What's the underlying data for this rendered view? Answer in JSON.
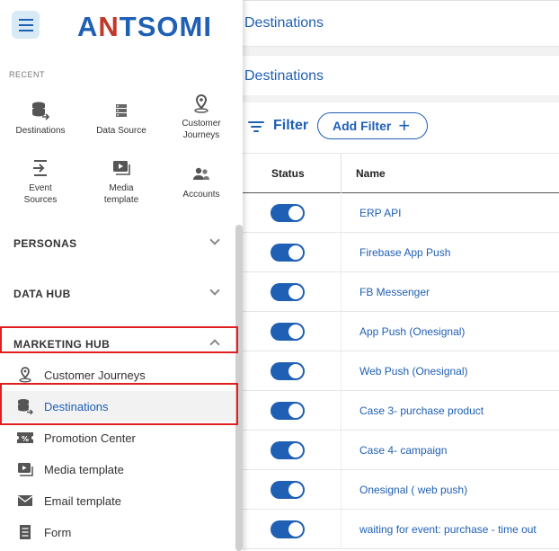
{
  "page": {
    "title": "Destinations",
    "subtitle": "Destinations"
  },
  "filter": {
    "label": "Filter",
    "add_label": "Add Filter",
    "add_icon": "plus-icon"
  },
  "table": {
    "columns": [
      "Status",
      "Name"
    ],
    "rows": [
      {
        "status": "on",
        "name": "ERP API"
      },
      {
        "status": "on",
        "name": "Firebase App Push"
      },
      {
        "status": "on",
        "name": "FB Messenger"
      },
      {
        "status": "on",
        "name": "App Push (Onesignal)"
      },
      {
        "status": "on",
        "name": "Web Push (Onesignal)"
      },
      {
        "status": "on",
        "name": "Case 3- purchase product"
      },
      {
        "status": "on",
        "name": "Case 4- campaign"
      },
      {
        "status": "on",
        "name": "Onesignal ( web push)"
      },
      {
        "status": "on",
        "name": "waiting for event: purchase - time out"
      }
    ]
  },
  "drawer": {
    "logo": {
      "pre": "A",
      "accent": "N",
      "post": "TSOMI"
    },
    "recent_label": "RECENT",
    "recent": [
      {
        "label": "Destinations",
        "icon": "database-arrow-icon"
      },
      {
        "label": "Data Source",
        "icon": "server-icon"
      },
      {
        "label": "Customer Journeys",
        "icon": "location-pin-icon"
      },
      {
        "label": "Event Sources",
        "icon": "import-icon"
      },
      {
        "label": "Media template",
        "icon": "media-play-icon"
      },
      {
        "label": "Accounts",
        "icon": "people-icon"
      }
    ],
    "sections": [
      {
        "label": "PERSONAS",
        "expanded": false
      },
      {
        "label": "DATA HUB",
        "expanded": false
      },
      {
        "label": "MARKETING HUB",
        "expanded": true
      }
    ],
    "items": [
      {
        "label": "Customer Journeys",
        "icon": "location-pin-icon",
        "active": false
      },
      {
        "label": "Destinations",
        "icon": "database-arrow-icon",
        "active": true
      },
      {
        "label": "Promotion Center",
        "icon": "percent-ticket-icon",
        "active": false
      },
      {
        "label": "Media template",
        "icon": "media-play-icon",
        "active": false
      },
      {
        "label": "Email template",
        "icon": "envelope-icon",
        "active": false
      },
      {
        "label": "Form",
        "icon": "form-icon",
        "active": false
      }
    ]
  },
  "colors": {
    "accent": "#1f5fb4",
    "logo_accent": "#c0392b",
    "highlight": "#e02020"
  }
}
